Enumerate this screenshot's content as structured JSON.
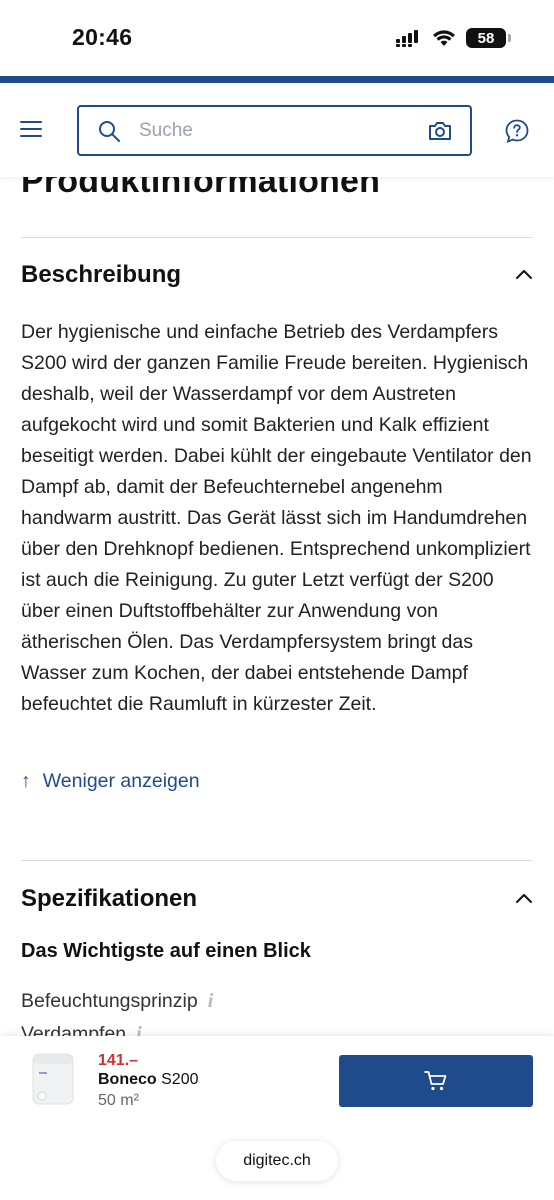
{
  "status_bar": {
    "time": "20:46",
    "battery": "58",
    "battery_level": 0.58
  },
  "header": {
    "menu_icon": "hamburger-menu-icon",
    "search": {
      "placeholder": "Suche",
      "value": ""
    },
    "search_icon": "search-icon",
    "camera_icon": "camera-icon",
    "help_icon": "help-icon",
    "accent_color": "#1f4b8c"
  },
  "content": {
    "page_heading": "Produktinformationen",
    "description": {
      "title": "Beschreibung",
      "text": "Der hygienische und einfache Betrieb des Verdampfers S200 wird der ganzen Familie Freude bereiten. Hygienisch deshalb, weil der Wasserdampf vor dem Austreten aufgekocht wird und somit Bakterien und Kalk effizient beseitigt werden. Dabei kühlt der eingebaute Ventilator den Dampf ab, damit der Befeuchternebel angenehm handwarm austritt. Das Gerät lässt sich im Handumdrehen über den Drehknopf bedienen. Entsprechend unkompliziert ist auch die Reinigung. Zu guter Letzt verfügt der S200 über einen Duftstoffbehälter zur Anwendung von ätherischen Ölen. Das Verdampfersystem bringt das Wasser zum Kochen, der dabei entstehende Dampf befeuchtet die Raumluft in kürzester Zeit.",
      "show_less_label": "Weniger anzeigen",
      "show_less_arrow": "↑"
    },
    "specifications": {
      "title": "Spezifikationen",
      "subheading": "Das Wichtigste auf einen Blick",
      "rows": [
        {
          "label": "Befeuchtungsprinzip",
          "info": "i"
        },
        {
          "label": "Verdampfen",
          "info": "i"
        }
      ]
    }
  },
  "bottom_bar": {
    "price": "141.–",
    "brand": "Boneco",
    "model": "S200",
    "area": "50 m²",
    "cart_icon": "shopping-cart-icon",
    "price_color": "#d32f2f",
    "url": "digitec.ch"
  }
}
